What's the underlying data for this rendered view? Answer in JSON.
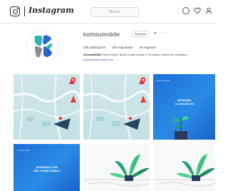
{
  "header": {
    "app_name": "Instagram",
    "search_placeholder": "Buscar",
    "nav_icons": [
      "compass-icon",
      "heart-icon",
      "user-icon"
    ]
  },
  "profile": {
    "username": "komsumobile",
    "follow_label": "Seguindo",
    "dropdown_label": "▾",
    "more_label": "···",
    "stats": {
      "posts": "258 publicações",
      "followers": "328 seguidores",
      "following": "25 seguindo"
    },
    "bio_name": "KomsuMOBI",
    "bio_text": "Komsumobile Brasil Conferencias e Fundacao Claves de Innovation",
    "website": "www.komsumobile.com"
  },
  "posts": [
    {
      "kind": "map",
      "title": ""
    },
    {
      "kind": "map",
      "title": ""
    },
    {
      "kind": "blue",
      "tag": "Komsumobile",
      "title": "APRENDA\nLA SEÇÃO 00"
    },
    {
      "kind": "blue",
      "tag": "Komsumobile",
      "title": "APRENDA COM\nSEU FONE MOBILE"
    },
    {
      "kind": "white",
      "title": ""
    },
    {
      "kind": "white",
      "title": ""
    }
  ],
  "colors": {
    "avatar_teal": "#2ab5b0",
    "avatar_blue": "#2c66c9",
    "avatar_gray": "#8a8f98",
    "post_blue": "#1e6fd6"
  }
}
